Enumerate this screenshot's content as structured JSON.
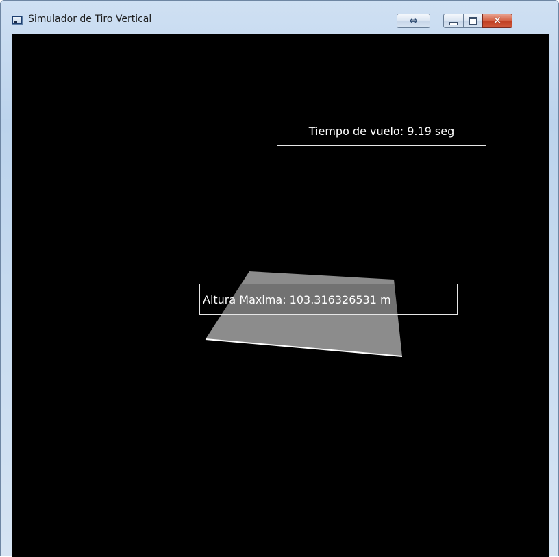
{
  "window": {
    "title": "Simulador de Tiro Vertical",
    "icon": "app-window-icon",
    "controls": {
      "swap_icon": "⇔",
      "minimize_icon": "minimize-icon",
      "maximize_icon": "maximize-icon",
      "close_icon": "✕"
    }
  },
  "scene": {
    "background_color": "#000000",
    "plane_color": "#8c8c8c",
    "edge_color": "#ffffff",
    "labels": {
      "flight_time": "Tiempo de vuelo: 9.19 seg",
      "max_height": "Altura Maxima: 103.316326531 m"
    }
  }
}
